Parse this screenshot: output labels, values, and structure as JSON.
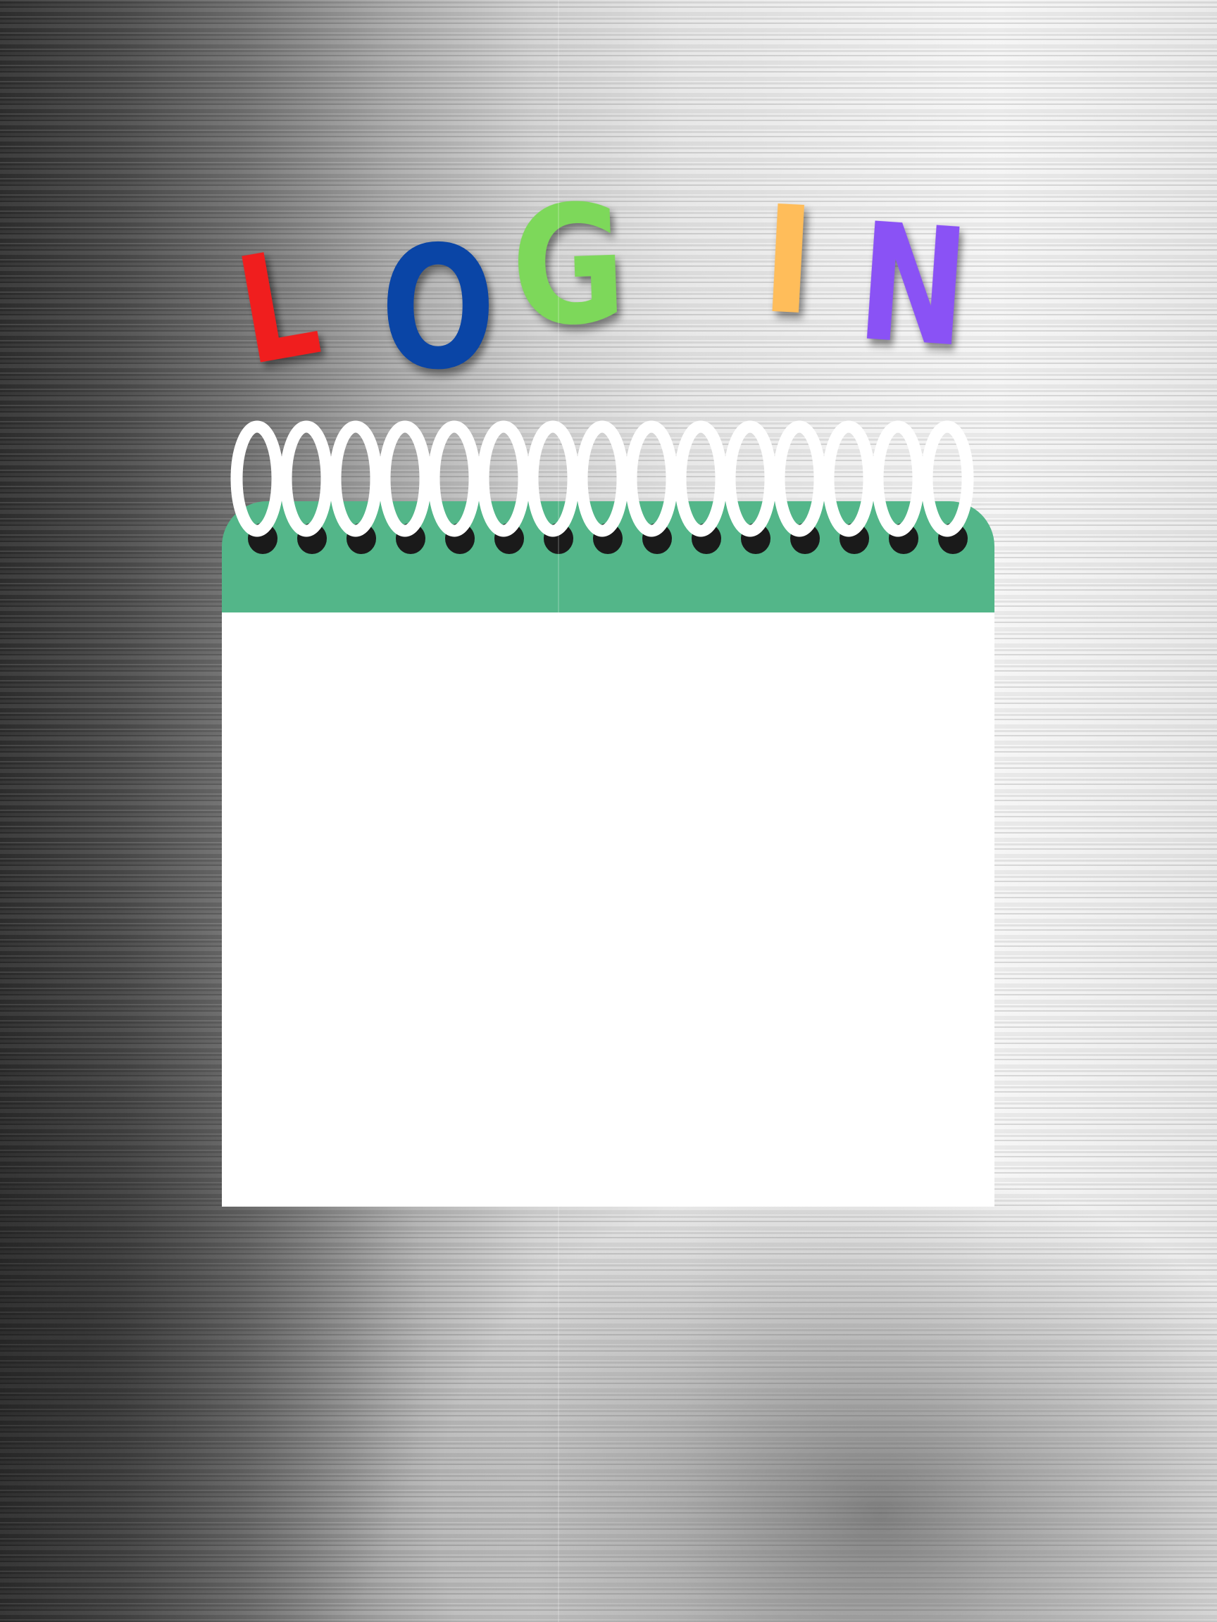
{
  "title": {
    "letters": [
      {
        "char": "L",
        "color": "#f01e1e"
      },
      {
        "char": "O",
        "color": "#0a45a6"
      },
      {
        "char": "G",
        "color": "#7dd85a"
      },
      {
        "char": "I",
        "color": "#ffbd5a"
      },
      {
        "char": "N",
        "color": "#8a52f5"
      }
    ]
  },
  "notepad": {
    "header_color": "#53b689",
    "sheet_color": "#ffffff",
    "binding_rings": 15
  }
}
